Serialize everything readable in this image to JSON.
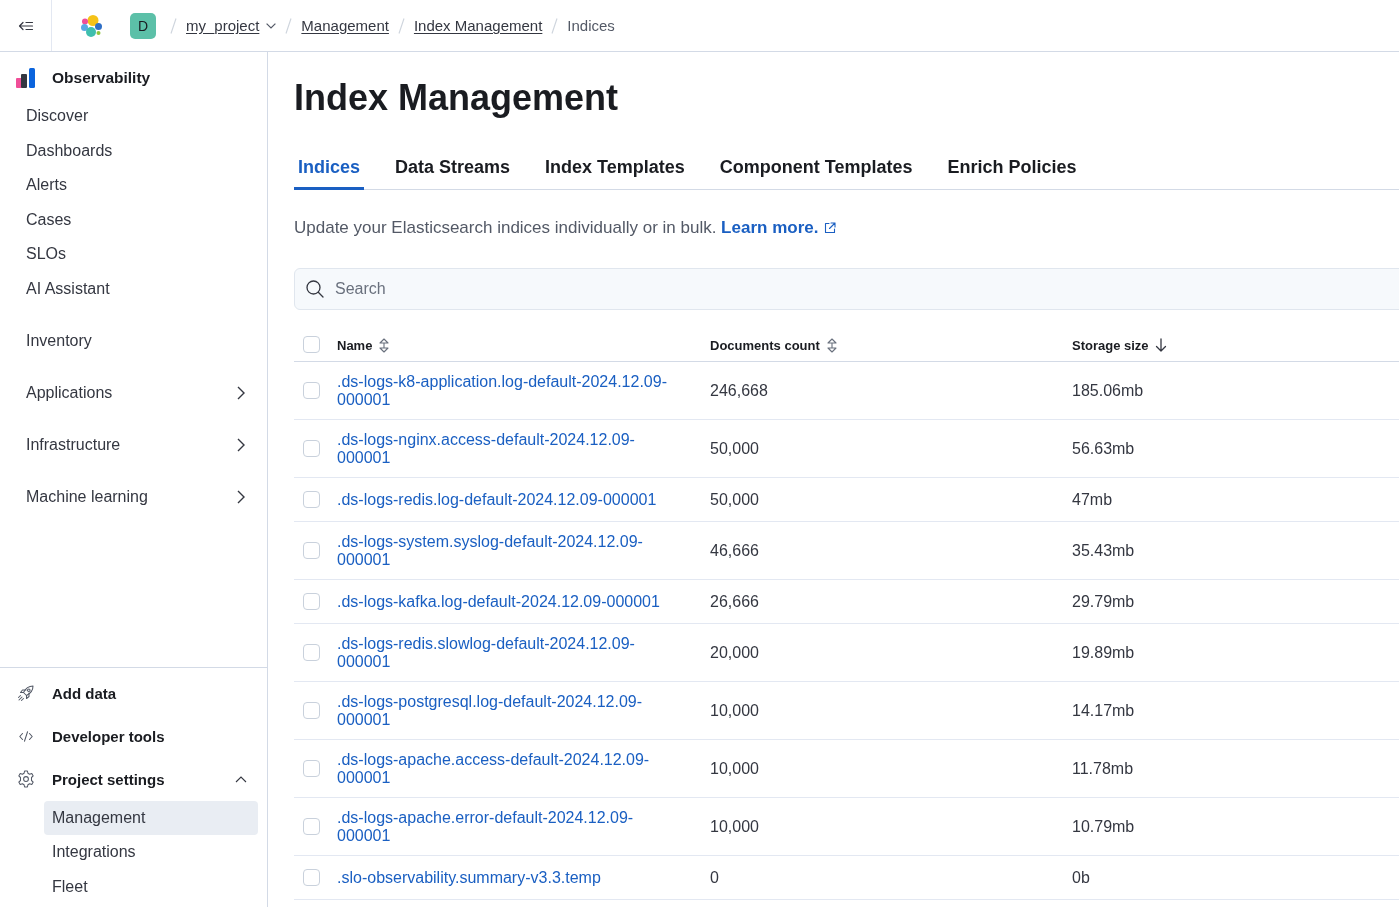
{
  "header": {
    "avatar": "D",
    "breadcrumbs": [
      {
        "label": "my_project",
        "kind": "dropdown"
      },
      {
        "label": "Management",
        "kind": "link"
      },
      {
        "label": "Index Management",
        "kind": "link"
      },
      {
        "label": "Indices",
        "kind": "current"
      }
    ]
  },
  "sidebar": {
    "title": "Observability",
    "items": [
      {
        "label": "Discover",
        "selected": false
      },
      {
        "label": "Dashboards",
        "selected": false
      },
      {
        "label": "Alerts",
        "selected": false
      },
      {
        "label": "Cases",
        "selected": false
      },
      {
        "label": "SLOs",
        "selected": false
      },
      {
        "label": "AI Assistant",
        "selected": false
      }
    ],
    "more_items": [
      {
        "label": "Inventory",
        "kind": "link",
        "selected": false
      },
      {
        "label": "Applications",
        "kind": "group",
        "expanded": false,
        "selected": false
      },
      {
        "label": "Infrastructure",
        "kind": "group",
        "expanded": false,
        "selected": false
      },
      {
        "label": "Machine learning",
        "kind": "group",
        "expanded": false,
        "selected": false
      }
    ],
    "footer_items": [
      {
        "label": "Add data",
        "kind": "link",
        "selected": false
      },
      {
        "label": "Developer tools",
        "kind": "link",
        "selected": false
      },
      {
        "label": "Project settings",
        "kind": "group",
        "expanded": true,
        "selected": false,
        "children": [
          {
            "label": "Management",
            "selected": true
          },
          {
            "label": "Integrations",
            "selected": false
          },
          {
            "label": "Fleet",
            "selected": false
          }
        ]
      }
    ]
  },
  "page": {
    "title": "Index Management",
    "tabs": [
      {
        "label": "Indices",
        "selected": true
      },
      {
        "label": "Data Streams",
        "selected": false
      },
      {
        "label": "Index Templates",
        "selected": false
      },
      {
        "label": "Component Templates",
        "selected": false
      },
      {
        "label": "Enrich Policies",
        "selected": false
      }
    ],
    "description": {
      "text": "Update your Elasticsearch indices individually or in bulk.",
      "link": "Learn more."
    },
    "search": {
      "placeholder": "Search"
    },
    "table": {
      "select_all": {
        "checked": false
      },
      "columns": [
        {
          "label": "Name",
          "sorted": false
        },
        {
          "label": "Documents count",
          "sorted": false
        },
        {
          "label": "Storage size",
          "sorted": true
        }
      ],
      "rows": [
        {
          "name": ".ds-logs-k8-application.log-default-2024.12.09-000001",
          "documents_count": "246,668",
          "storage_size": "185.06mb",
          "checked": false
        },
        {
          "name": ".ds-logs-nginx.access-default-2024.12.09-000001",
          "documents_count": "50,000",
          "storage_size": "56.63mb",
          "checked": false
        },
        {
          "name": ".ds-logs-redis.log-default-2024.12.09-000001",
          "documents_count": "50,000",
          "storage_size": "47mb",
          "checked": false
        },
        {
          "name": ".ds-logs-system.syslog-default-2024.12.09-000001",
          "documents_count": "46,666",
          "storage_size": "35.43mb",
          "checked": false
        },
        {
          "name": ".ds-logs-kafka.log-default-2024.12.09-000001",
          "documents_count": "26,666",
          "storage_size": "29.79mb",
          "checked": false
        },
        {
          "name": ".ds-logs-redis.slowlog-default-2024.12.09-000001",
          "documents_count": "20,000",
          "storage_size": "19.89mb",
          "checked": false
        },
        {
          "name": ".ds-logs-postgresql.log-default-2024.12.09-000001",
          "documents_count": "10,000",
          "storage_size": "14.17mb",
          "checked": false
        },
        {
          "name": ".ds-logs-apache.access-default-2024.12.09-000001",
          "documents_count": "10,000",
          "storage_size": "11.78mb",
          "checked": false
        },
        {
          "name": ".ds-logs-apache.error-default-2024.12.09-000001",
          "documents_count": "10,000",
          "storage_size": "10.79mb",
          "checked": false
        },
        {
          "name": ".slo-observability.summary-v3.3.temp",
          "documents_count": "0",
          "storage_size": "0b",
          "checked": false
        }
      ]
    }
  }
}
